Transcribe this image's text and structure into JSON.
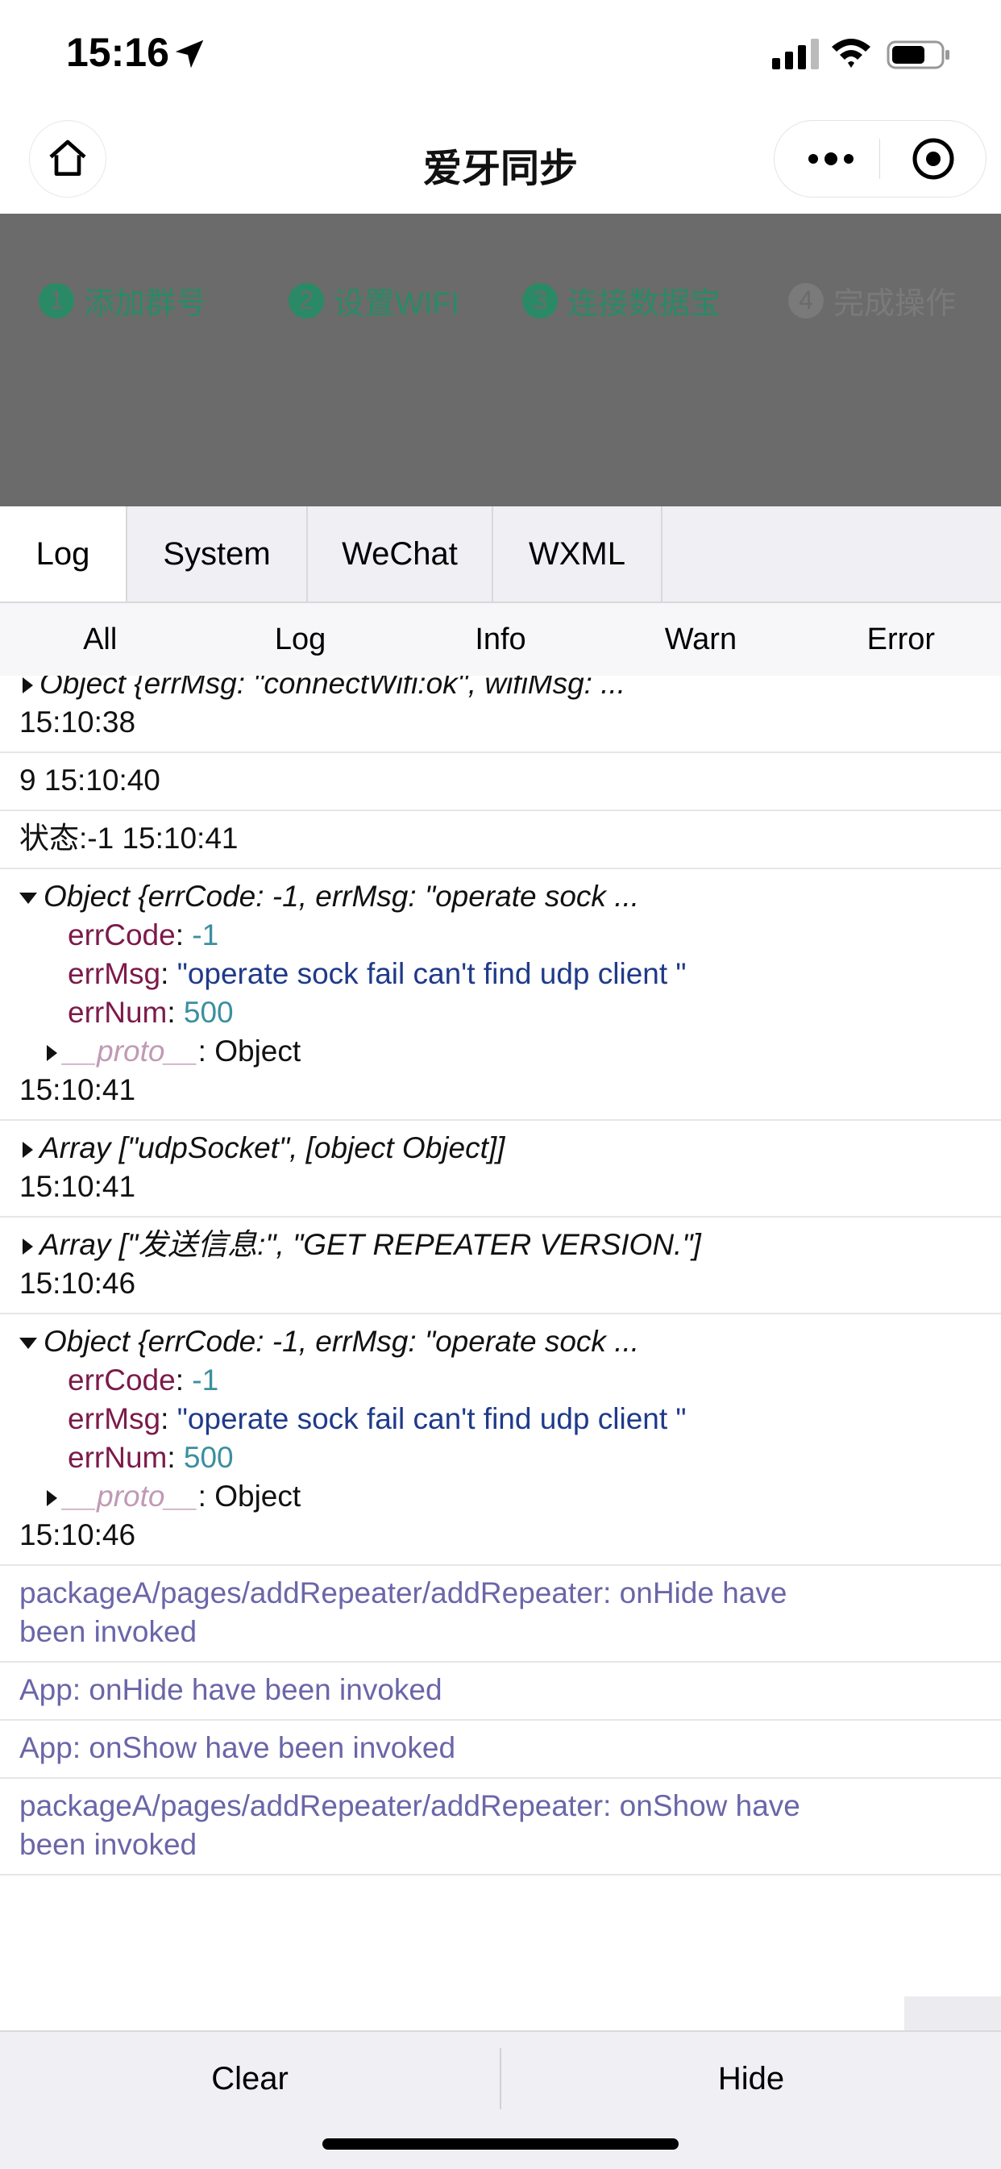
{
  "status_bar": {
    "time": "15:16"
  },
  "nav": {
    "title": "爱牙同步"
  },
  "steps": [
    {
      "num": "1",
      "label": "添加群号"
    },
    {
      "num": "2",
      "label": "设置WIFI"
    },
    {
      "num": "3",
      "label": "连接数据宝"
    },
    {
      "num": "4",
      "label": "完成操作"
    }
  ],
  "tabs": [
    "Log",
    "System",
    "WeChat",
    "WXML"
  ],
  "filters": [
    "All",
    "Log",
    "Info",
    "Warn",
    "Error"
  ],
  "logs": {
    "l0": {
      "text": "Object {errMsg: \"connectWifi:ok\", wifiMsg: ...",
      "time": "15:10:38"
    },
    "l1": {
      "text": "9 15:10:40"
    },
    "l2": {
      "text": "状态:-1 15:10:41"
    },
    "l3": {
      "summary": "Object {errCode: -1, errMsg: \"operate sock ...",
      "k1": "errCode",
      "v1": "-1",
      "k2": "errMsg",
      "v2": "\"operate sock fail can't find udp client \"",
      "k3": "errNum",
      "v3": "500",
      "proto": "__proto__",
      "proto_val": ": Object",
      "time": "15:10:41"
    },
    "l4": {
      "summary": "Array [\"udpSocket\", [object Object]]",
      "time": "15:10:41"
    },
    "l5": {
      "summary": "Array [\"发送信息:\", \"GET REPEATER VERSION.\"]",
      "time": "15:10:46"
    },
    "l6": {
      "summary": "Object {errCode: -1, errMsg: \"operate sock ...",
      "k1": "errCode",
      "v1": "-1",
      "k2": "errMsg",
      "v2": "\"operate sock fail can't find udp client \"",
      "k3": "errNum",
      "v3": "500",
      "proto": "__proto__",
      "proto_val": ": Object",
      "time": "15:10:46"
    },
    "l7": {
      "text": "packageA/pages/addRepeater/addRepeater: onHide have been invoked"
    },
    "l8": {
      "text": "App: onHide have been invoked"
    },
    "l9": {
      "text": "App: onShow have been invoked"
    },
    "l10": {
      "text": "packageA/pages/addRepeater/addRepeater: onShow have been invoked"
    }
  },
  "bottom": {
    "clear": "Clear",
    "hide": "Hide"
  }
}
